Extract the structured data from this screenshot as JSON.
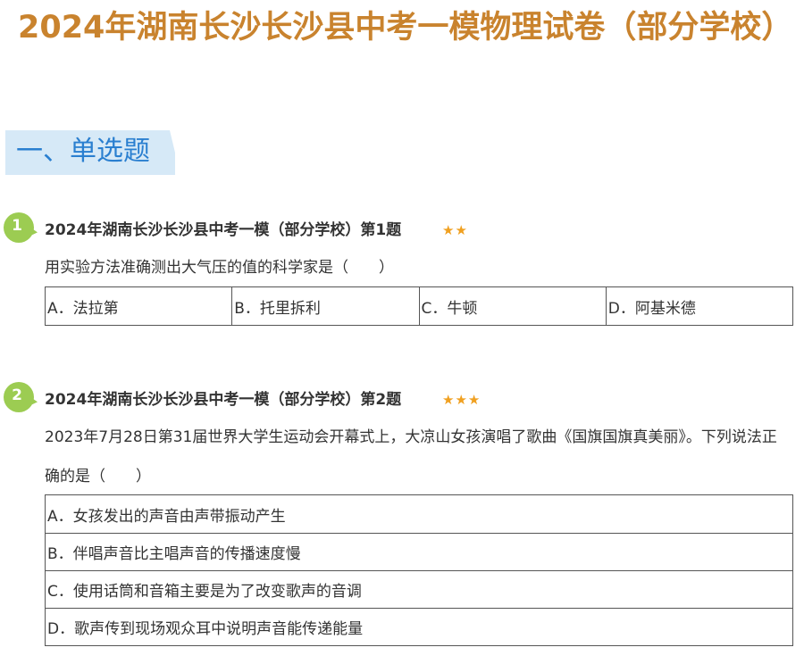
{
  "page": {
    "title": "2024年湖南长沙长沙县中考一模物理试卷（部分学校）"
  },
  "section": {
    "title": "一、单选题"
  },
  "colors": {
    "title": "#c9832e",
    "section_text": "#2a7fd0",
    "section_bg": "#d6e9f7",
    "badge": "#9ccc52",
    "stars": "#f0a020"
  },
  "questions": [
    {
      "number": "1",
      "source": "2024年湖南长沙长沙县中考一模（部分学校）第1题",
      "stars": "★★",
      "difficulty": 2,
      "stem": "用实验方法准确测出大气压的值的科学家是（　　）",
      "options": [
        "A．法拉第",
        "B．托里拆利",
        "C．牛顿",
        "D．阿基米德"
      ]
    },
    {
      "number": "2",
      "source": "2024年湖南长沙长沙县中考一模（部分学校）第2题",
      "stars": "★★★",
      "difficulty": 3,
      "stem": "2023年7月28日第31届世界大学生运动会开幕式上，大凉山女孩演唱了歌曲《国旗国旗真美丽》。下列说法正确的是（　　）",
      "options": [
        "A．女孩发出的声音由声带振动产生",
        "B．伴唱声音比主唱声音的传播速度慢",
        "C．使用话筒和音箱主要是为了改变歌声的音调",
        "D．歌声传到现场观众耳中说明声音能传递能量"
      ]
    }
  ]
}
